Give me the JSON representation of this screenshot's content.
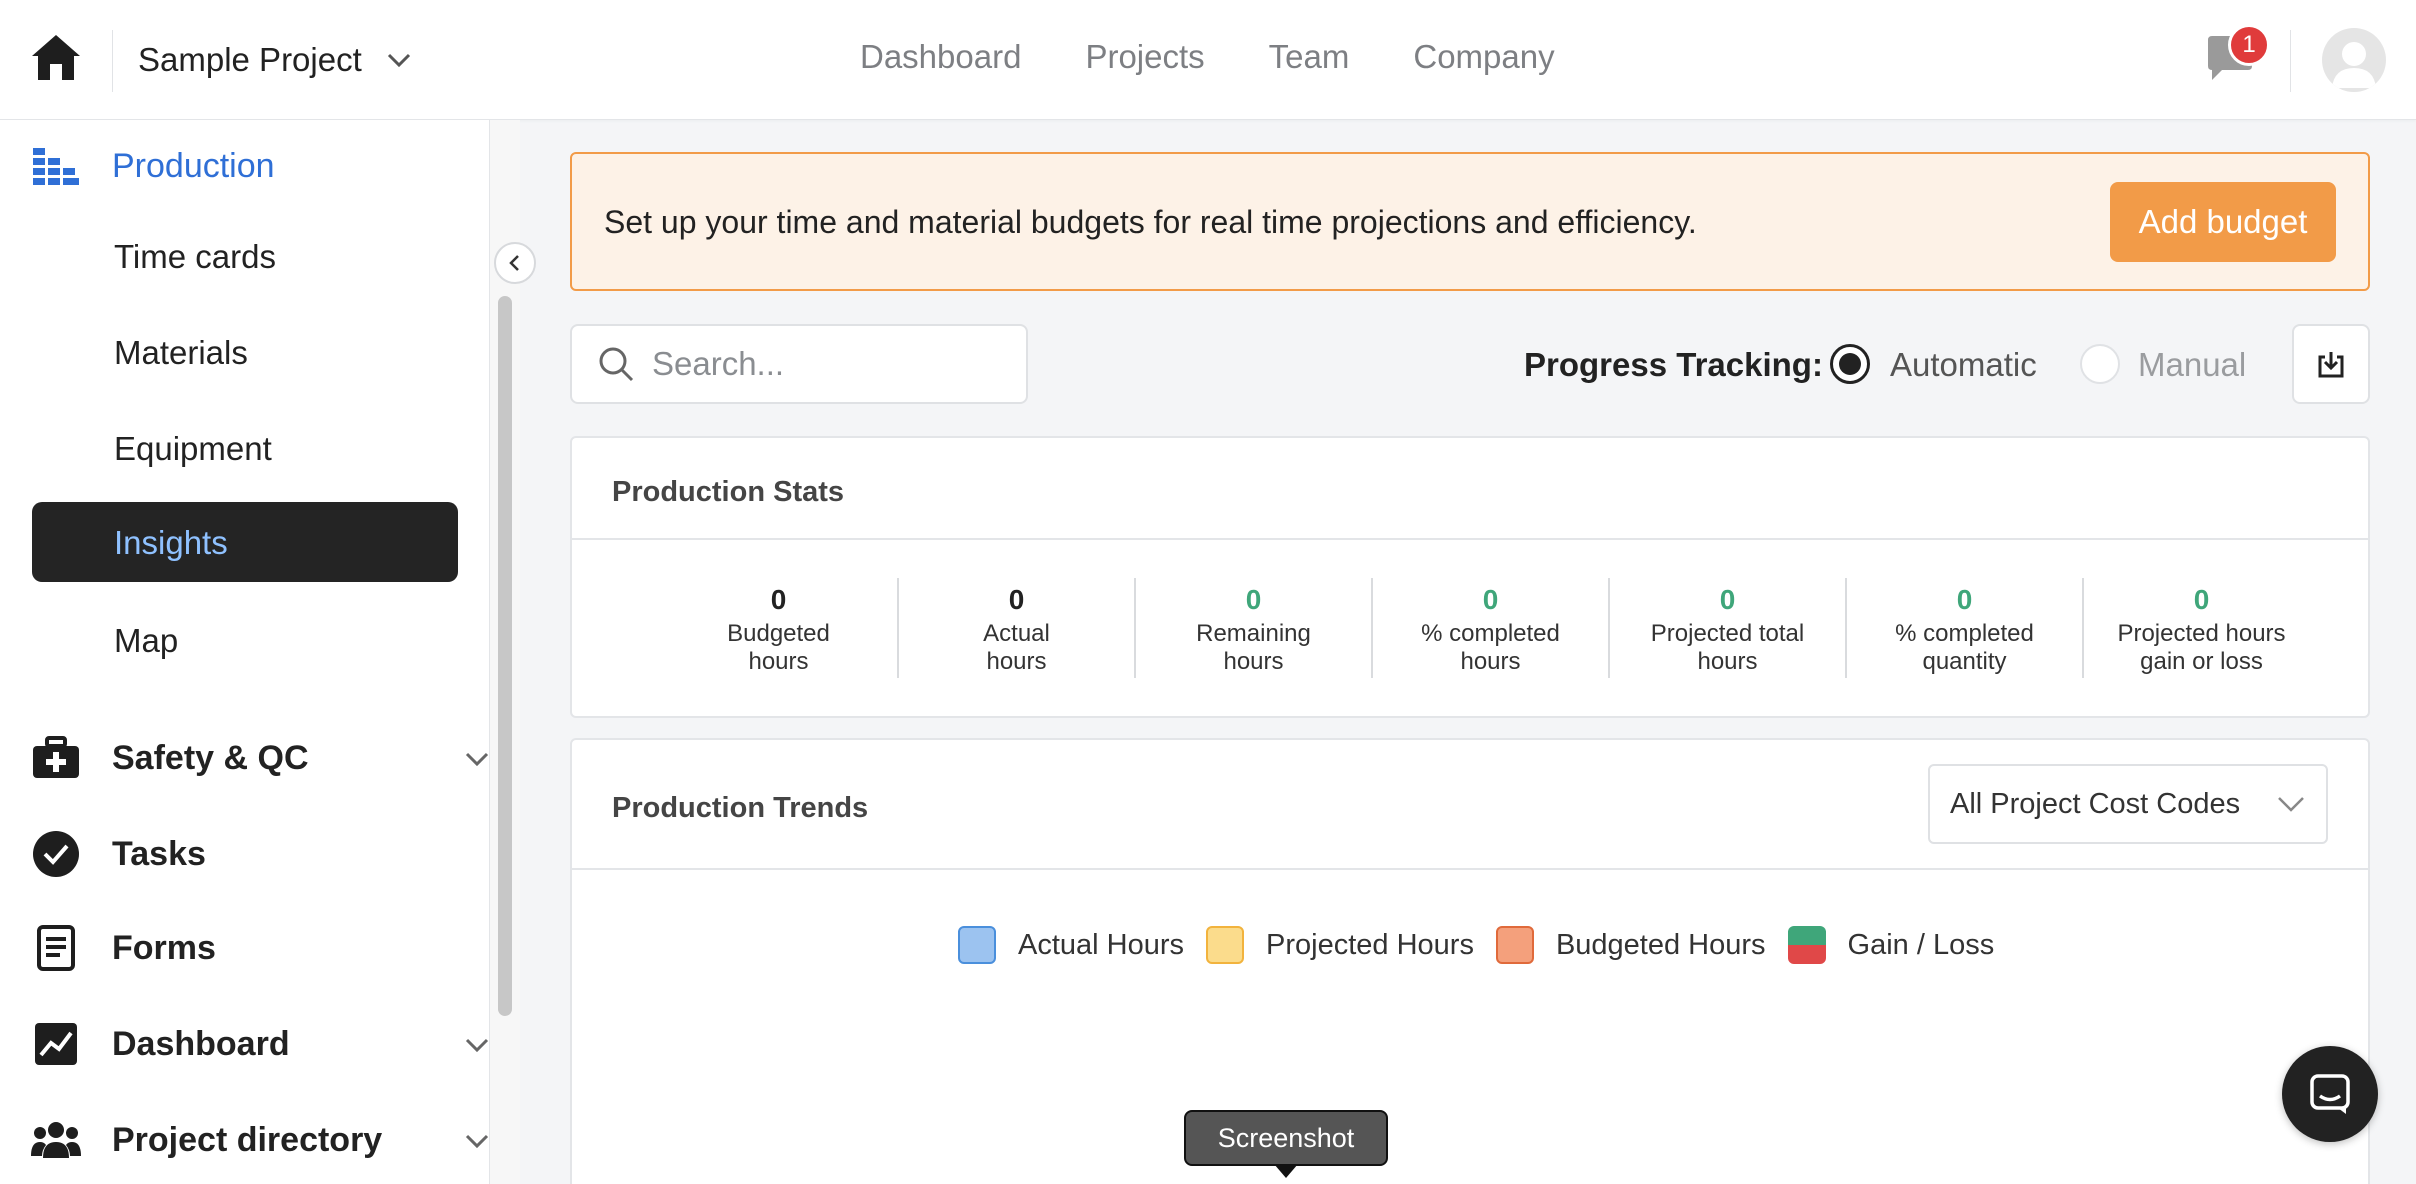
{
  "header": {
    "project_name": "Sample Project",
    "nav": [
      "Dashboard",
      "Projects",
      "Team",
      "Company"
    ],
    "notification_count": "1"
  },
  "sidebar": {
    "production": {
      "label": "Production",
      "items": [
        "Time cards",
        "Materials",
        "Equipment",
        "Insights",
        "Map"
      ],
      "active": "Insights"
    },
    "sections": [
      "Safety & QC",
      "Tasks",
      "Forms",
      "Dashboard",
      "Project directory"
    ]
  },
  "banner": {
    "text": "Set up your time and material budgets for real time projections and efficiency.",
    "button": "Add budget"
  },
  "toolbar": {
    "search_placeholder": "Search...",
    "progress_label": "Progress Tracking:",
    "option_automatic": "Automatic",
    "option_manual": "Manual",
    "selected": "Automatic"
  },
  "stats": {
    "title": "Production Stats",
    "items": [
      {
        "value": "0",
        "l1": "Budgeted",
        "l2": "hours",
        "color": "#222222"
      },
      {
        "value": "0",
        "l1": "Actual",
        "l2": "hours",
        "color": "#222222"
      },
      {
        "value": "0",
        "l1": "Remaining",
        "l2": "hours",
        "color": "#3fa67a"
      },
      {
        "value": "0",
        "l1": "% completed",
        "l2": "hours",
        "color": "#3fa67a"
      },
      {
        "value": "0",
        "l1": "Projected total",
        "l2": "hours",
        "color": "#3fa67a"
      },
      {
        "value": "0",
        "l1": "% completed",
        "l2": "quantity",
        "color": "#3fa67a"
      },
      {
        "value": "0",
        "l1": "Projected hours",
        "l2": "gain or loss",
        "color": "#3fa67a"
      }
    ]
  },
  "trends": {
    "title": "Production Trends",
    "filter": "All Project Cost Codes",
    "legend": [
      {
        "label": "Actual Hours",
        "fill": "#9cc3f0",
        "border": "#4a8fdc"
      },
      {
        "label": "Projected Hours",
        "fill": "#fbdc8c",
        "border": "#f2b33d"
      },
      {
        "label": "Budgeted Hours",
        "fill": "#f4a07c",
        "border": "#e06a3b"
      },
      {
        "label": "Gain / Loss",
        "fill": "#3fa67a",
        "fill2": "#e04848",
        "border": "#3fa67a"
      }
    ]
  },
  "tooltip": "Screenshot",
  "colors": {
    "accent_blue": "#2f6fd6",
    "orange": "#f29b48",
    "green": "#3fa67a"
  }
}
